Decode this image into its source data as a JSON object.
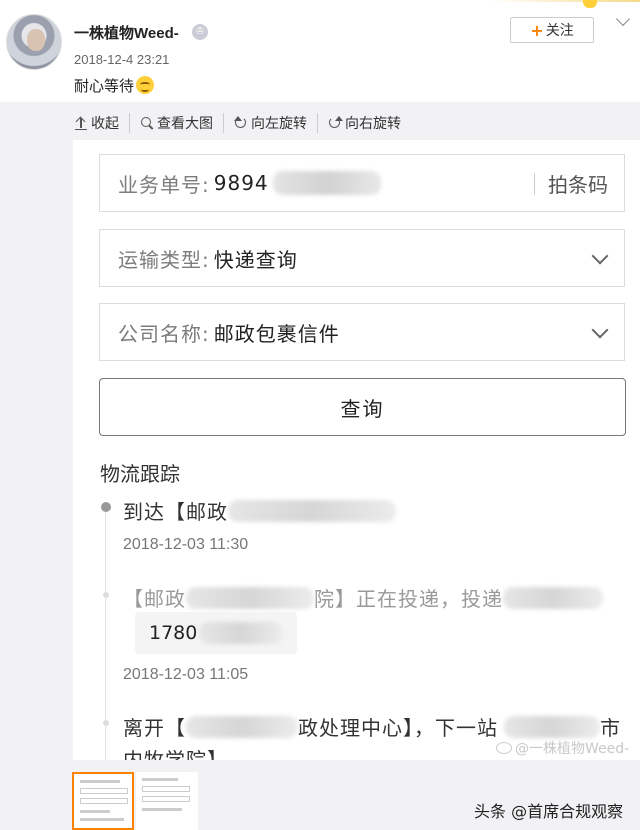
{
  "post": {
    "username": "一株植物Weed-",
    "timestamp": "2018-12-4 23:21",
    "text": "耐心等待",
    "follow_label": "关注",
    "follow_plus": "+"
  },
  "toolbar": {
    "collapse": "收起",
    "view_large": "查看大图",
    "rotate_left": "向左旋转",
    "rotate_right": "向右旋转"
  },
  "form": {
    "order_label": "业务单号:",
    "order_value": "9894",
    "scan_label": "拍条码",
    "transport_label": "运输类型:",
    "transport_value": "快递查询",
    "company_label": "公司名称:",
    "company_value": "邮政包裹信件",
    "query_button": "查询"
  },
  "tracking": {
    "title": "物流跟踪",
    "events": [
      {
        "text_a": "到达【邮政",
        "text_b": "",
        "time": "2018-12-03 11:30"
      },
      {
        "text_a": "【邮政",
        "text_b": "院】正在投递，投递",
        "phone_prefix": "1780",
        "time": "2018-12-03 11:05"
      },
      {
        "text_a": "离开【",
        "text_b": "政处理中心】，下一站",
        "text_c": "市",
        "text_d": "内牧学院】"
      }
    ]
  },
  "watermark": "@一株植物Weed-",
  "footer_credit": "头条 @首席合规观察",
  "icons": [
    "avatar",
    "badge-icon",
    "emoji-icon",
    "collapse-icon",
    "search-icon",
    "rotate-left-icon",
    "rotate-right-icon",
    "chevron-down-icon"
  ]
}
